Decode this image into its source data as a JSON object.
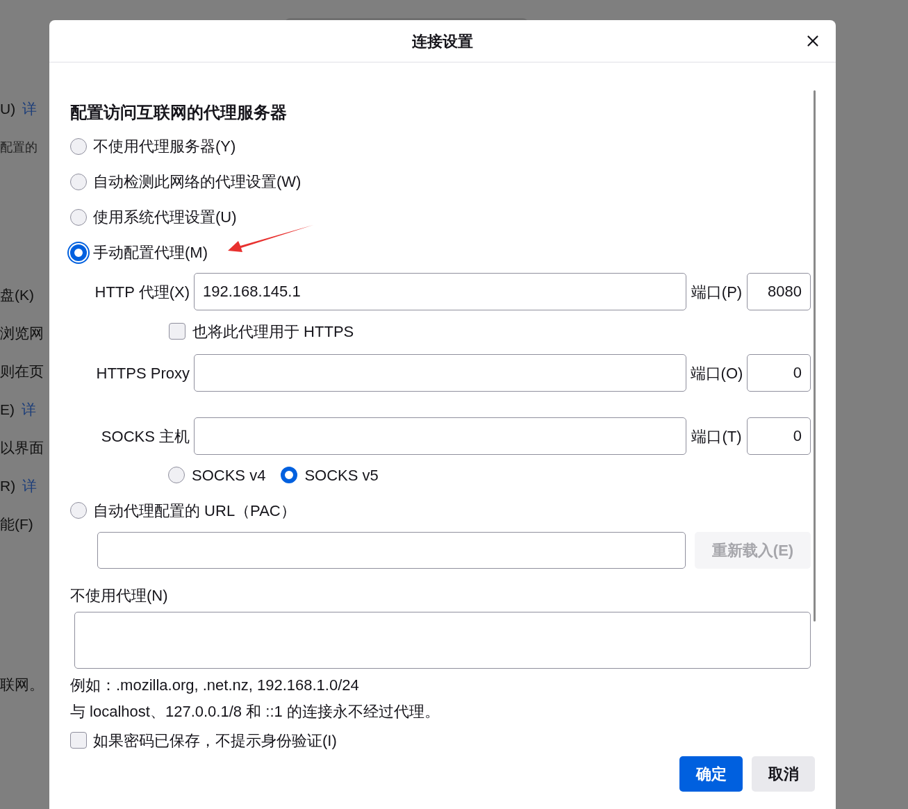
{
  "background_sections": [
    {
      "items": [
        {
          "text": "U)",
          "link": "详"
        },
        {
          "text": "配置的",
          "small": true
        }
      ]
    },
    {
      "items": [
        {
          "text": "盘(K)"
        },
        {
          "text": "浏览网"
        },
        {
          "text": "则在页"
        },
        {
          "text": "E)",
          "link": "详"
        },
        {
          "text": "以界面"
        },
        {
          "text": "R)",
          "link": "详"
        },
        {
          "text": "能(F)"
        }
      ]
    },
    {
      "items": [
        {
          "text": "联网。"
        }
      ]
    }
  ],
  "dialog": {
    "title": "连接设置"
  },
  "heading": "配置访问互联网的代理服务器",
  "proxy_modes": [
    {
      "label": "不使用代理服务器(Y)",
      "selected": false
    },
    {
      "label": "自动检测此网络的代理设置(W)",
      "selected": false
    },
    {
      "label": "使用系统代理设置(U)",
      "selected": false
    },
    {
      "label": "手动配置代理(M)",
      "selected": true
    }
  ],
  "manual": {
    "http": {
      "label": "HTTP 代理(X)",
      "value": "192.168.145.1",
      "port_label": "端口(P)",
      "port_value": "8080"
    },
    "also_https": {
      "label": "也将此代理用于 HTTPS",
      "checked": false
    },
    "https": {
      "label": "HTTPS Proxy",
      "port_label": "端口(O)",
      "port_value": "0"
    },
    "socks": {
      "label": "SOCKS 主机",
      "port_label": "端口(T)",
      "port_value": "0"
    },
    "socks_versions": [
      {
        "label": "SOCKS v4",
        "selected": false
      },
      {
        "label": "SOCKS v5",
        "selected": true
      }
    ]
  },
  "pac": {
    "label": "自动代理配置的 URL（PAC）",
    "selected": false,
    "reload_button": "重新载入(E)",
    "reload_disabled": true
  },
  "no_proxy": {
    "label": "不使用代理(N)",
    "hints": [
      "例如：.mozilla.org, .net.nz, 192.168.1.0/24",
      "与 localhost、127.0.0.1/8 和 ::1 的连接永不经过代理。"
    ]
  },
  "auth_checkbox": {
    "label": "如果密码已保存，不提示身份验证(I)",
    "checked": false
  },
  "buttons": [
    {
      "label": "确定",
      "kind": "primary"
    },
    {
      "label": "取消",
      "kind": "secondary"
    }
  ]
}
